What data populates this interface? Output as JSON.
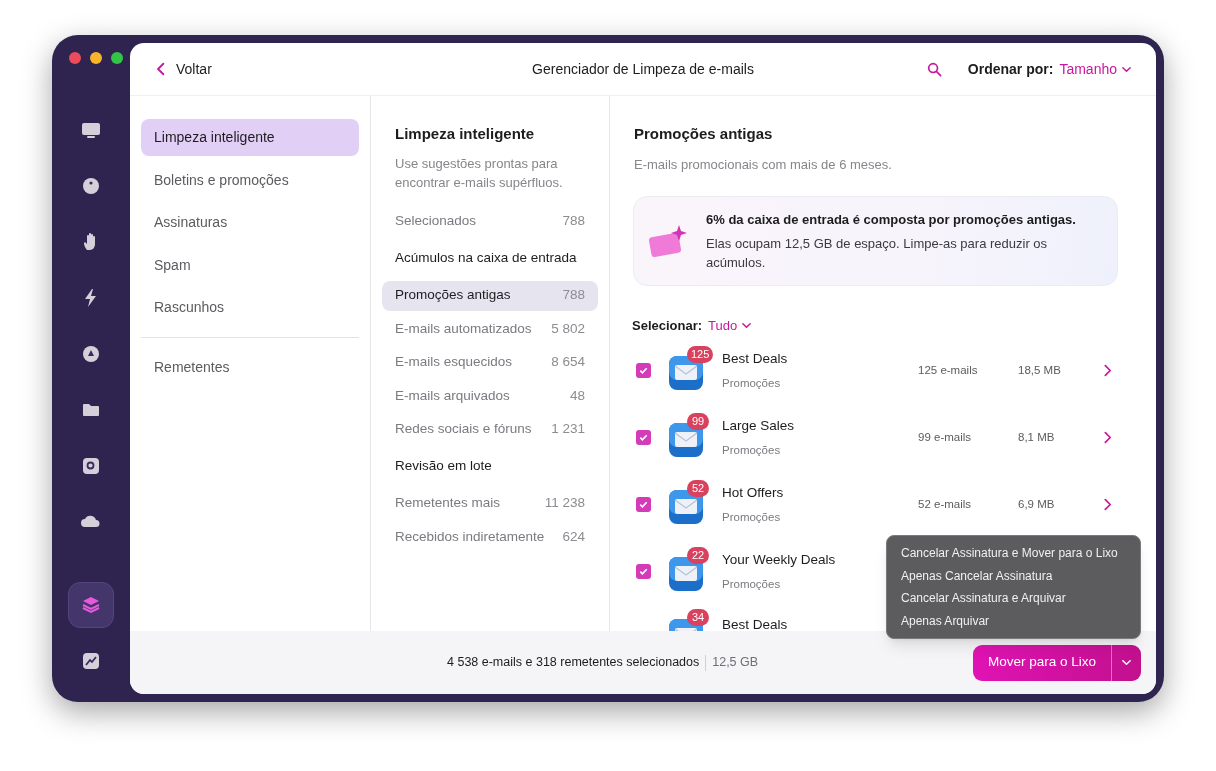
{
  "window": {
    "title": "Gerenciador de Limpeza de e-mails",
    "back": "Voltar",
    "sort_label": "Ordenar por:",
    "sort_value": "Tamanho"
  },
  "rail": [
    {
      "selected": false
    },
    {
      "selected": false
    },
    {
      "selected": false
    },
    {
      "selected": false
    },
    {
      "selected": false
    },
    {
      "selected": false
    },
    {
      "selected": false
    },
    {
      "selected": false
    },
    {
      "selected": true
    },
    {
      "selected": false
    }
  ],
  "sidebar": {
    "items": [
      {
        "label": "Limpeza inteligente",
        "selected": true
      },
      {
        "label": "Boletins e promoções",
        "selected": false
      },
      {
        "label": "Assinaturas",
        "selected": false
      },
      {
        "label": "Spam",
        "selected": false
      },
      {
        "label": "Rascunhos",
        "selected": false
      }
    ],
    "footer_items": [
      {
        "label": "Remetentes",
        "selected": false
      }
    ]
  },
  "categories": {
    "title": "Limpeza inteligente",
    "description": "Use sugestões prontas para encontrar e-mails supérfluos.",
    "items": [
      {
        "kind": "item",
        "label": "Selecionados",
        "count": "788",
        "selected": false
      },
      {
        "kind": "header",
        "label": "Acúmulos na caixa de entrada"
      },
      {
        "kind": "item",
        "label": "Promoções antigas",
        "count": "788",
        "selected": true
      },
      {
        "kind": "item",
        "label": "E-mails automatizados",
        "count": "5 802",
        "selected": false
      },
      {
        "kind": "item",
        "label": "E-mails esquecidos",
        "count": "8 654",
        "selected": false
      },
      {
        "kind": "item",
        "label": "E-mails arquivados",
        "count": "48",
        "selected": false
      },
      {
        "kind": "item",
        "label": "Redes sociais e fóruns",
        "count": "1 231",
        "selected": false
      },
      {
        "kind": "header",
        "label": "Revisão em lote"
      },
      {
        "kind": "item",
        "label": "Remetentes mais",
        "count": "11 238",
        "selected": false
      },
      {
        "kind": "item",
        "label": "Recebidos indiretamente",
        "count": "624",
        "selected": false
      }
    ]
  },
  "detail": {
    "title": "Promoções antigas",
    "subtitle": "E-mails promocionais com mais de 6 meses.",
    "info_card": {
      "headline": "6% da caixa de entrada é composta por promoções antigas.",
      "body": "Elas ocupam 12,5 GB de espaço. Limpe-as para reduzir os acúmulos."
    },
    "select_label": "Selecionar:",
    "select_value": "Tudo",
    "senders": [
      {
        "name": "Best Deals",
        "badge": "125",
        "category": "Promoções",
        "emails": "125 e-mails",
        "size": "18,5 MB",
        "checked": true
      },
      {
        "name": "Large Sales",
        "badge": "99",
        "category": "Promoções",
        "emails": "99 e-mails",
        "size": "8,1 MB",
        "checked": true
      },
      {
        "name": "Hot Offers",
        "badge": "52",
        "category": "Promoções",
        "emails": "52 e-mails",
        "size": "6,9 MB",
        "checked": true
      },
      {
        "name": "Your Weekly Deals",
        "badge": "22",
        "category": "Promoções",
        "checked": true
      },
      {
        "name": "Best Deals",
        "badge": "34"
      }
    ]
  },
  "status_bar": {
    "summary": "4 538 e-mails e 318 remetentes selecionados",
    "size": "12,5 GB",
    "button": "Mover para o Lixo"
  },
  "action_menu": [
    "Cancelar Assinatura e Mover para o Lixo",
    "Apenas Cancelar Assinatura",
    "Cancelar Assinatura e Arquivar",
    "Apenas Arquivar"
  ]
}
